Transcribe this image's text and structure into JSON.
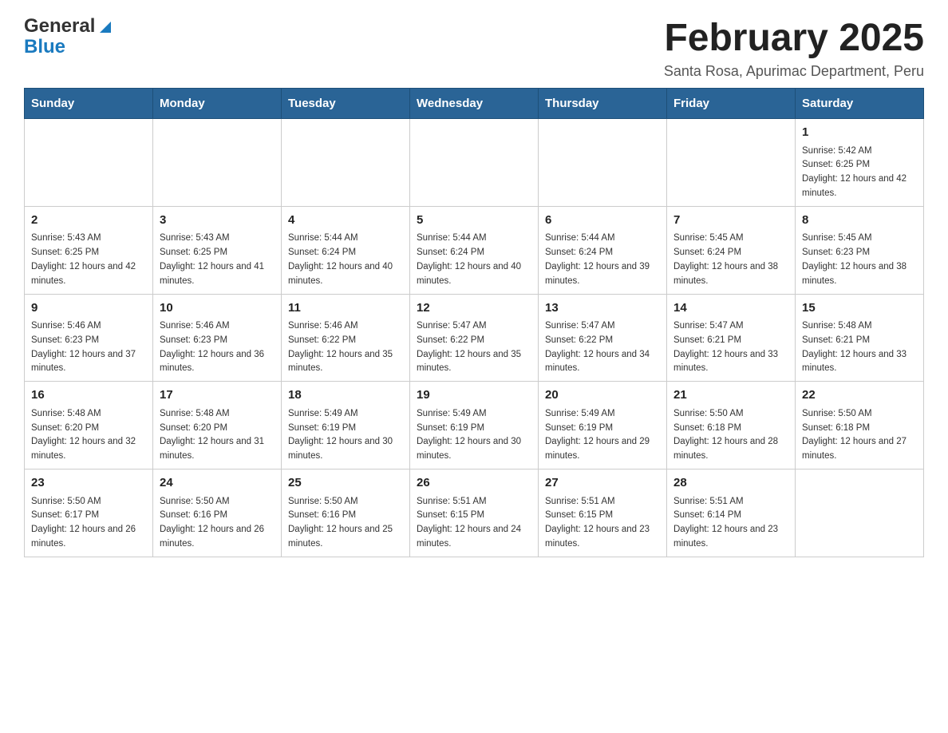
{
  "header": {
    "logo_general": "General",
    "logo_blue": "Blue",
    "title": "February 2025",
    "subtitle": "Santa Rosa, Apurimac Department, Peru"
  },
  "weekdays": [
    "Sunday",
    "Monday",
    "Tuesday",
    "Wednesday",
    "Thursday",
    "Friday",
    "Saturday"
  ],
  "weeks": [
    [
      {
        "day": "",
        "info": ""
      },
      {
        "day": "",
        "info": ""
      },
      {
        "day": "",
        "info": ""
      },
      {
        "day": "",
        "info": ""
      },
      {
        "day": "",
        "info": ""
      },
      {
        "day": "",
        "info": ""
      },
      {
        "day": "1",
        "info": "Sunrise: 5:42 AM\nSunset: 6:25 PM\nDaylight: 12 hours and 42 minutes."
      }
    ],
    [
      {
        "day": "2",
        "info": "Sunrise: 5:43 AM\nSunset: 6:25 PM\nDaylight: 12 hours and 42 minutes."
      },
      {
        "day": "3",
        "info": "Sunrise: 5:43 AM\nSunset: 6:25 PM\nDaylight: 12 hours and 41 minutes."
      },
      {
        "day": "4",
        "info": "Sunrise: 5:44 AM\nSunset: 6:24 PM\nDaylight: 12 hours and 40 minutes."
      },
      {
        "day": "5",
        "info": "Sunrise: 5:44 AM\nSunset: 6:24 PM\nDaylight: 12 hours and 40 minutes."
      },
      {
        "day": "6",
        "info": "Sunrise: 5:44 AM\nSunset: 6:24 PM\nDaylight: 12 hours and 39 minutes."
      },
      {
        "day": "7",
        "info": "Sunrise: 5:45 AM\nSunset: 6:24 PM\nDaylight: 12 hours and 38 minutes."
      },
      {
        "day": "8",
        "info": "Sunrise: 5:45 AM\nSunset: 6:23 PM\nDaylight: 12 hours and 38 minutes."
      }
    ],
    [
      {
        "day": "9",
        "info": "Sunrise: 5:46 AM\nSunset: 6:23 PM\nDaylight: 12 hours and 37 minutes."
      },
      {
        "day": "10",
        "info": "Sunrise: 5:46 AM\nSunset: 6:23 PM\nDaylight: 12 hours and 36 minutes."
      },
      {
        "day": "11",
        "info": "Sunrise: 5:46 AM\nSunset: 6:22 PM\nDaylight: 12 hours and 35 minutes."
      },
      {
        "day": "12",
        "info": "Sunrise: 5:47 AM\nSunset: 6:22 PM\nDaylight: 12 hours and 35 minutes."
      },
      {
        "day": "13",
        "info": "Sunrise: 5:47 AM\nSunset: 6:22 PM\nDaylight: 12 hours and 34 minutes."
      },
      {
        "day": "14",
        "info": "Sunrise: 5:47 AM\nSunset: 6:21 PM\nDaylight: 12 hours and 33 minutes."
      },
      {
        "day": "15",
        "info": "Sunrise: 5:48 AM\nSunset: 6:21 PM\nDaylight: 12 hours and 33 minutes."
      }
    ],
    [
      {
        "day": "16",
        "info": "Sunrise: 5:48 AM\nSunset: 6:20 PM\nDaylight: 12 hours and 32 minutes."
      },
      {
        "day": "17",
        "info": "Sunrise: 5:48 AM\nSunset: 6:20 PM\nDaylight: 12 hours and 31 minutes."
      },
      {
        "day": "18",
        "info": "Sunrise: 5:49 AM\nSunset: 6:19 PM\nDaylight: 12 hours and 30 minutes."
      },
      {
        "day": "19",
        "info": "Sunrise: 5:49 AM\nSunset: 6:19 PM\nDaylight: 12 hours and 30 minutes."
      },
      {
        "day": "20",
        "info": "Sunrise: 5:49 AM\nSunset: 6:19 PM\nDaylight: 12 hours and 29 minutes."
      },
      {
        "day": "21",
        "info": "Sunrise: 5:50 AM\nSunset: 6:18 PM\nDaylight: 12 hours and 28 minutes."
      },
      {
        "day": "22",
        "info": "Sunrise: 5:50 AM\nSunset: 6:18 PM\nDaylight: 12 hours and 27 minutes."
      }
    ],
    [
      {
        "day": "23",
        "info": "Sunrise: 5:50 AM\nSunset: 6:17 PM\nDaylight: 12 hours and 26 minutes."
      },
      {
        "day": "24",
        "info": "Sunrise: 5:50 AM\nSunset: 6:16 PM\nDaylight: 12 hours and 26 minutes."
      },
      {
        "day": "25",
        "info": "Sunrise: 5:50 AM\nSunset: 6:16 PM\nDaylight: 12 hours and 25 minutes."
      },
      {
        "day": "26",
        "info": "Sunrise: 5:51 AM\nSunset: 6:15 PM\nDaylight: 12 hours and 24 minutes."
      },
      {
        "day": "27",
        "info": "Sunrise: 5:51 AM\nSunset: 6:15 PM\nDaylight: 12 hours and 23 minutes."
      },
      {
        "day": "28",
        "info": "Sunrise: 5:51 AM\nSunset: 6:14 PM\nDaylight: 12 hours and 23 minutes."
      },
      {
        "day": "",
        "info": ""
      }
    ]
  ]
}
